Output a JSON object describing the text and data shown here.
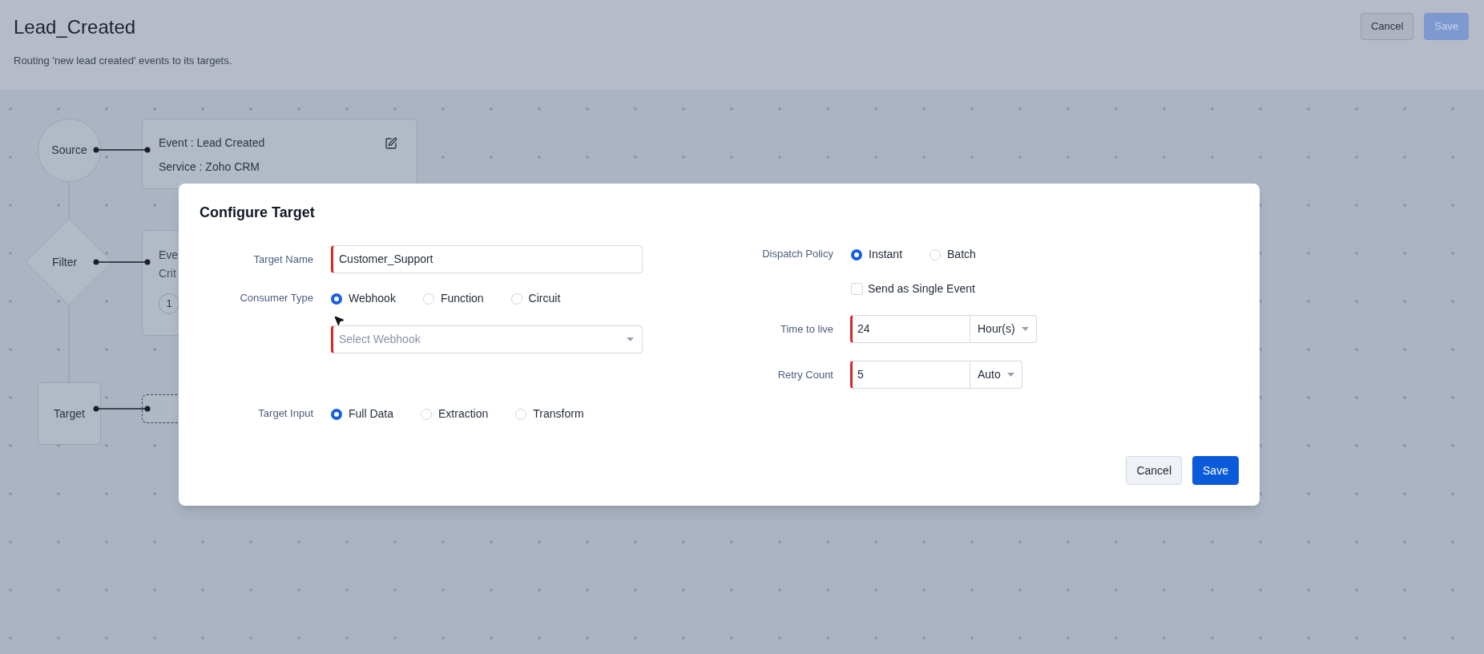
{
  "page": {
    "title": "Lead_Created",
    "description": "Routing 'new lead created' events to its targets.",
    "actions": [
      {
        "label": "Cancel",
        "kind": "secondary"
      },
      {
        "label": "Save",
        "kind": "primary"
      }
    ]
  },
  "flow": {
    "nodes": [
      {
        "kind": "circle",
        "label": "Source",
        "card": {
          "kind": "solid",
          "lines": [
            "Event : Lead Created",
            "Service : Zoho CRM"
          ],
          "editable": true
        }
      },
      {
        "kind": "diamond",
        "label": "Filter",
        "card": {
          "kind": "partial",
          "lines": [
            "Eve",
            "Crit"
          ],
          "badge": "1"
        }
      },
      {
        "kind": "square",
        "label": "Target",
        "card": {
          "kind": "dashed"
        }
      }
    ]
  },
  "dialog": {
    "title": "Configure Target",
    "left_fields": [
      {
        "kind": "text",
        "label": "Target Name",
        "value": "Customer_Support",
        "required": true
      },
      {
        "kind": "radio",
        "label": "Consumer Type",
        "options": [
          {
            "label": "Webhook",
            "selected": true
          },
          {
            "label": "Function",
            "selected": false
          },
          {
            "label": "Circuit",
            "selected": false
          }
        ]
      },
      {
        "kind": "select",
        "placeholder": "Select Webhook",
        "required": true
      },
      {
        "kind": "radio",
        "label": "Target Input",
        "options": [
          {
            "label": "Full Data",
            "selected": true
          },
          {
            "label": "Extraction",
            "selected": false
          },
          {
            "label": "Transform",
            "selected": false
          }
        ]
      }
    ],
    "right_fields": [
      {
        "kind": "radio",
        "label": "Dispatch Policy",
        "options": [
          {
            "label": "Instant",
            "selected": true
          },
          {
            "label": "Batch",
            "selected": false
          }
        ]
      },
      {
        "kind": "checkbox",
        "label": "Send as Single Event",
        "checked": false
      },
      {
        "kind": "number_unit",
        "label": "Time to live",
        "value": "24",
        "unit": "Hour(s)",
        "required": true
      },
      {
        "kind": "number_unit",
        "label": "Retry Count",
        "value": "5",
        "unit": "Auto",
        "required": true
      }
    ],
    "buttons": [
      {
        "label": "Cancel",
        "kind": "secondary"
      },
      {
        "label": "Save",
        "kind": "primary"
      }
    ]
  }
}
